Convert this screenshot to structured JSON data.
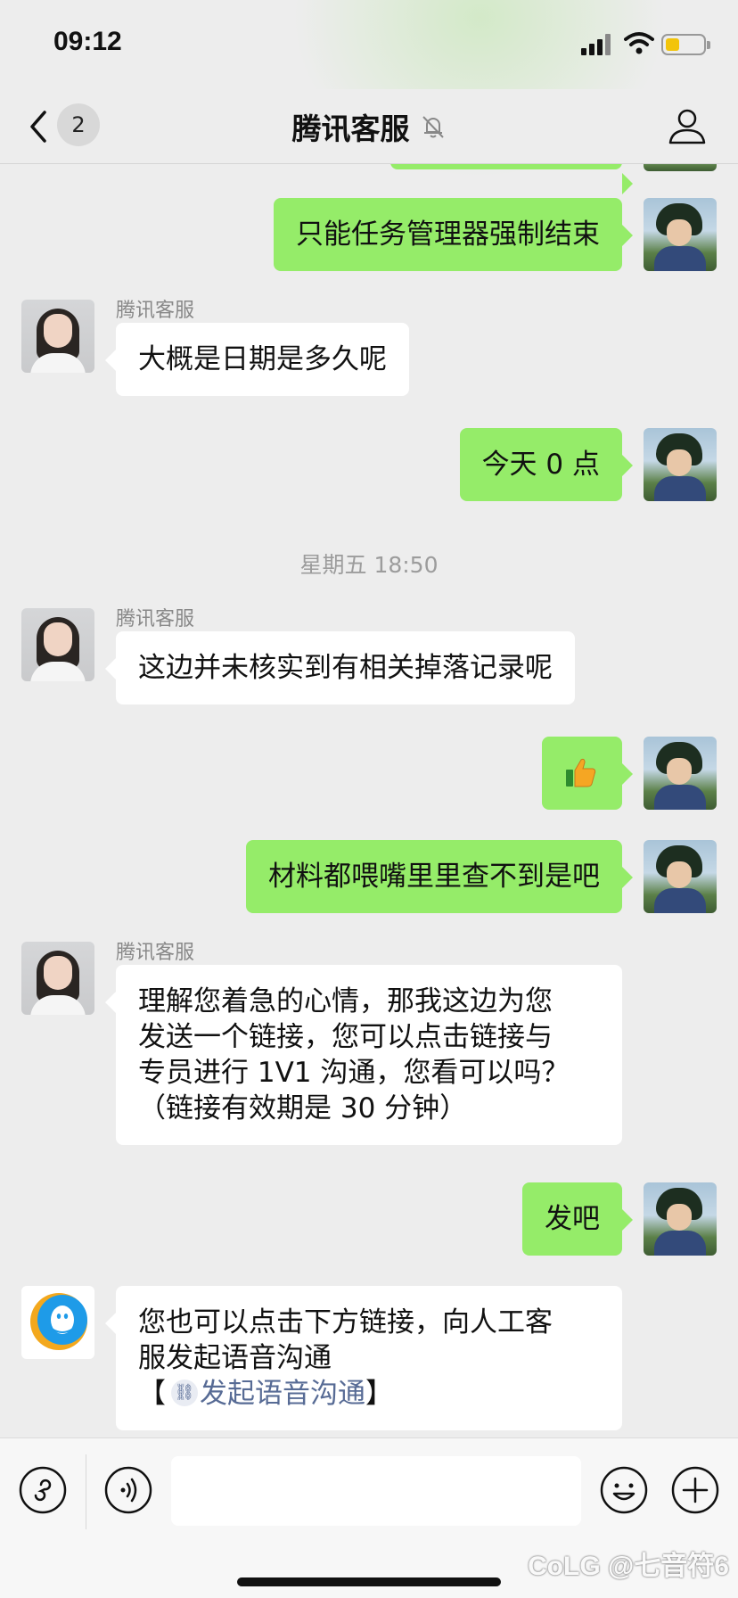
{
  "status_bar": {
    "time": "09:12",
    "battery_color": "#f2c40a"
  },
  "header": {
    "unread_count": "2",
    "title": "腾讯客服",
    "icons": [
      "back-chevron-icon",
      "mute-bell-icon",
      "profile-icon"
    ]
  },
  "colors": {
    "outgoing_bubble": "#95ec69",
    "incoming_bubble": "#ffffff",
    "background": "#ededed",
    "link": "#576b95"
  },
  "messages": [
    {
      "direction": "out",
      "text": "只能任务管理器强制结束"
    },
    {
      "direction": "in",
      "sender": "腾讯客服",
      "text": "大概是日期是多久呢"
    },
    {
      "direction": "out",
      "text": "今天 0 点"
    },
    {
      "type": "timestamp",
      "text": "星期五 18:50"
    },
    {
      "direction": "in",
      "sender": "腾讯客服",
      "text": "这边并未核实到有相关掉落记录呢"
    },
    {
      "direction": "out",
      "type": "emoji",
      "emoji": "thumbs-up"
    },
    {
      "direction": "out",
      "text": "材料都喂嘴里里查不到是吧"
    },
    {
      "direction": "in",
      "sender": "腾讯客服",
      "text": "理解您着急的心情，那我这边为您\n发送一个链接，您可以点击链接与\n专员进行 1V1 沟通，您看可以吗？\n（链接有效期是 30 分钟）"
    },
    {
      "direction": "out",
      "text": "发吧"
    },
    {
      "direction": "in",
      "avatar": "qq-service-icon",
      "text": "您也可以点击下方链接，向人工客\n服发起语音沟通",
      "link_open": "【",
      "link_text": "发起语音沟通",
      "link_close": "】"
    }
  ],
  "input_bar": {
    "value": "",
    "icons": [
      "mini-program-icon",
      "voice-icon",
      "emoji-icon",
      "plus-icon"
    ]
  },
  "watermark": "CoLG @七音符6"
}
